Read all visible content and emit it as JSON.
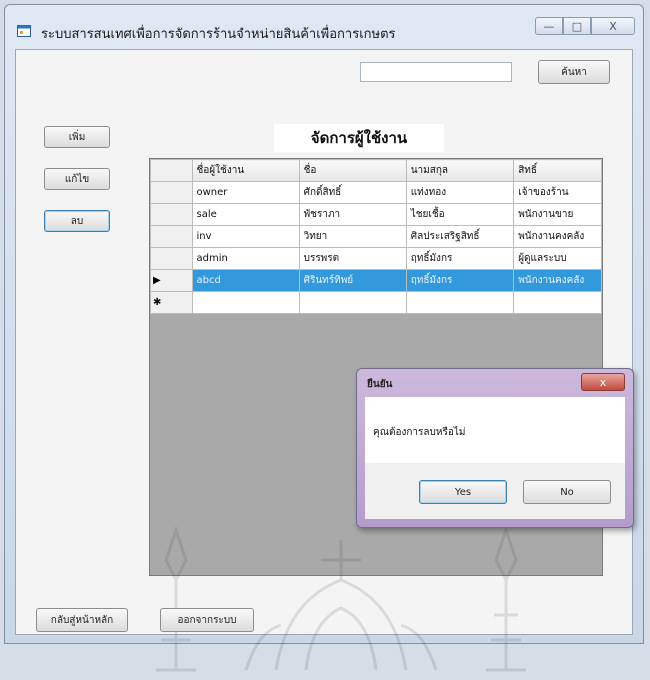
{
  "window": {
    "title": "ระบบสารสนเทศเพื่อการจัดการร้านจำหน่ายสินค้าเพื่อการเกษตร",
    "minimize_glyph": "—",
    "maximize_glyph": "□",
    "close_glyph": "X"
  },
  "search": {
    "value": "",
    "button_label": "ค้นหา"
  },
  "page_title": "จัดการผู้ใช้งาน",
  "actions": {
    "add_label": "เพิ่ม",
    "edit_label": "แก้ไข",
    "delete_label": "ลบ"
  },
  "table": {
    "columns": [
      "ชื่อผู้ใช้งาน",
      "ชื่อ",
      "นามสกุล",
      "สิทธิ์"
    ],
    "rows": [
      [
        "owner",
        "ศักดิ์สิทธิ์",
        "แท่งทอง",
        "เจ้าของร้าน"
      ],
      [
        "sale",
        "พัชราภา",
        "ไชยเชื้อ",
        "พนักงานขาย"
      ],
      [
        "inv",
        "วิทยา",
        "ศิลประเสริฐสิทธิ์",
        "พนักงานคงคลัง"
      ],
      [
        "admin",
        "บรรพรต",
        "ฤทธิ์มังกร",
        "ผู้ดูแลระบบ"
      ],
      [
        "abcd",
        "ศิรินทร์ทิพย์",
        "ฤทธิ์มังกร",
        "พนักงานคงคลัง"
      ]
    ],
    "selected_row_marker": "▶",
    "new_row_marker": "✱"
  },
  "dialog": {
    "title": "ยืนยัน",
    "message": "คุณต้องการลบหรือไม่",
    "yes_label": "Yes",
    "no_label": "No",
    "close_glyph": "x"
  },
  "footer": {
    "home_label": "กลับสู่หน้าหลัก",
    "exit_label": "ออกจากระบบ"
  },
  "colors": {
    "selection": "#3399dd",
    "dialog_frame": "#b59ccb"
  }
}
